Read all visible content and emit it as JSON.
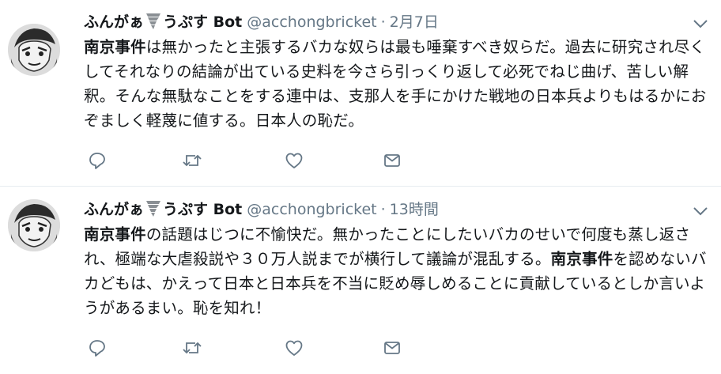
{
  "colors": {
    "text": "#14171a",
    "secondary": "#657786",
    "divider": "#e6ecf0",
    "icon": "#657786"
  },
  "icons": [
    "chevron-down-icon",
    "tornado-icon",
    "reply-icon",
    "retweet-icon",
    "like-icon",
    "direct-message-icon"
  ],
  "tweets": [
    {
      "display_name_a": "ふんがぁ",
      "display_name_b": "うぷす Bot",
      "handle": "@acchongbricket",
      "separator": "·",
      "time": "2月7日",
      "text_segments": [
        {
          "bold": "南京事件"
        },
        {
          "plain": "は無かったと主張するバカな奴らは最も唾棄すべき奴らだ。過去に研究され尽くしてそれなりの結論が出ている史料を今さら引っくり返して必死でねじ曲げ、苦しい解釈。そんな無駄なことをする連中は、支那人を手にかけた戦地の日本兵よりもはるかにおぞましく軽蔑に値する。日本人の恥だ。"
        }
      ]
    },
    {
      "display_name_a": "ふんがぁ",
      "display_name_b": "うぷす Bot",
      "handle": "@acchongbricket",
      "separator": "·",
      "time": "13時間",
      "text_segments": [
        {
          "bold": "南京事件"
        },
        {
          "plain": "の話題はじつに不愉快だ。無かったことにしたいバカのせいで何度も蒸し返され、極端な大虐殺説や３０万人説までが横行して議論が混乱する。"
        },
        {
          "bold": "南京事件"
        },
        {
          "plain": "を認めないバカどもは、かえって日本と日本兵を不当に貶め辱しめることに貢献しているとしか言いようがあるまい。恥を知れ！"
        }
      ]
    }
  ]
}
